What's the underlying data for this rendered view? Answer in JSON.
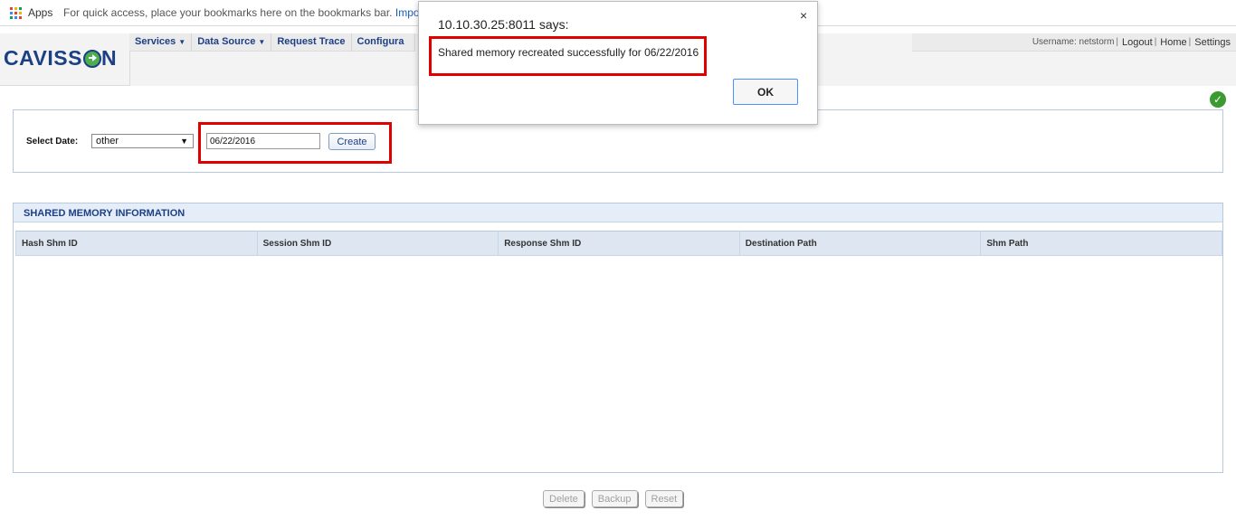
{
  "bookmarks": {
    "apps_label": "Apps",
    "hint": "For quick access, place your bookmarks here on the bookmarks bar.",
    "import_link": "Impo"
  },
  "header": {
    "logo_left": "CAVISS",
    "logo_right": "N",
    "nav": [
      {
        "label": "Services",
        "has_dropdown": true
      },
      {
        "label": "Data Source",
        "has_dropdown": true
      },
      {
        "label": "Request Trace",
        "has_dropdown": false
      },
      {
        "label": "Configura",
        "has_dropdown": false
      }
    ],
    "username_text": "Username: netstorm",
    "logout": "Logout",
    "home": "Home",
    "settings": "Settings",
    "separator": "|"
  },
  "status_icon": "check-circle-icon",
  "date_panel": {
    "label": "Select Date:",
    "select_value": "other",
    "date_value": "06/22/2016",
    "create_label": "Create"
  },
  "shm": {
    "title": "SHARED MEMORY INFORMATION",
    "columns": [
      "Hash Shm ID",
      "Session Shm ID",
      "Response Shm ID",
      "Destination Path",
      "Shm Path"
    ],
    "rows": []
  },
  "buttons": {
    "delete": "Delete",
    "backup": "Backup",
    "reset": "Reset"
  },
  "dialog": {
    "title": "10.10.30.25:8011 says:",
    "message": "Shared memory recreated successfully for 06/22/2016",
    "ok_label": "OK",
    "close_glyph": "×"
  },
  "colors": {
    "brand_blue": "#1c3f86",
    "brand_green": "#4cae4c",
    "highlight_red": "#e00000",
    "panel_border": "#b7c9dc",
    "table_header_bg": "#dde6f1"
  }
}
